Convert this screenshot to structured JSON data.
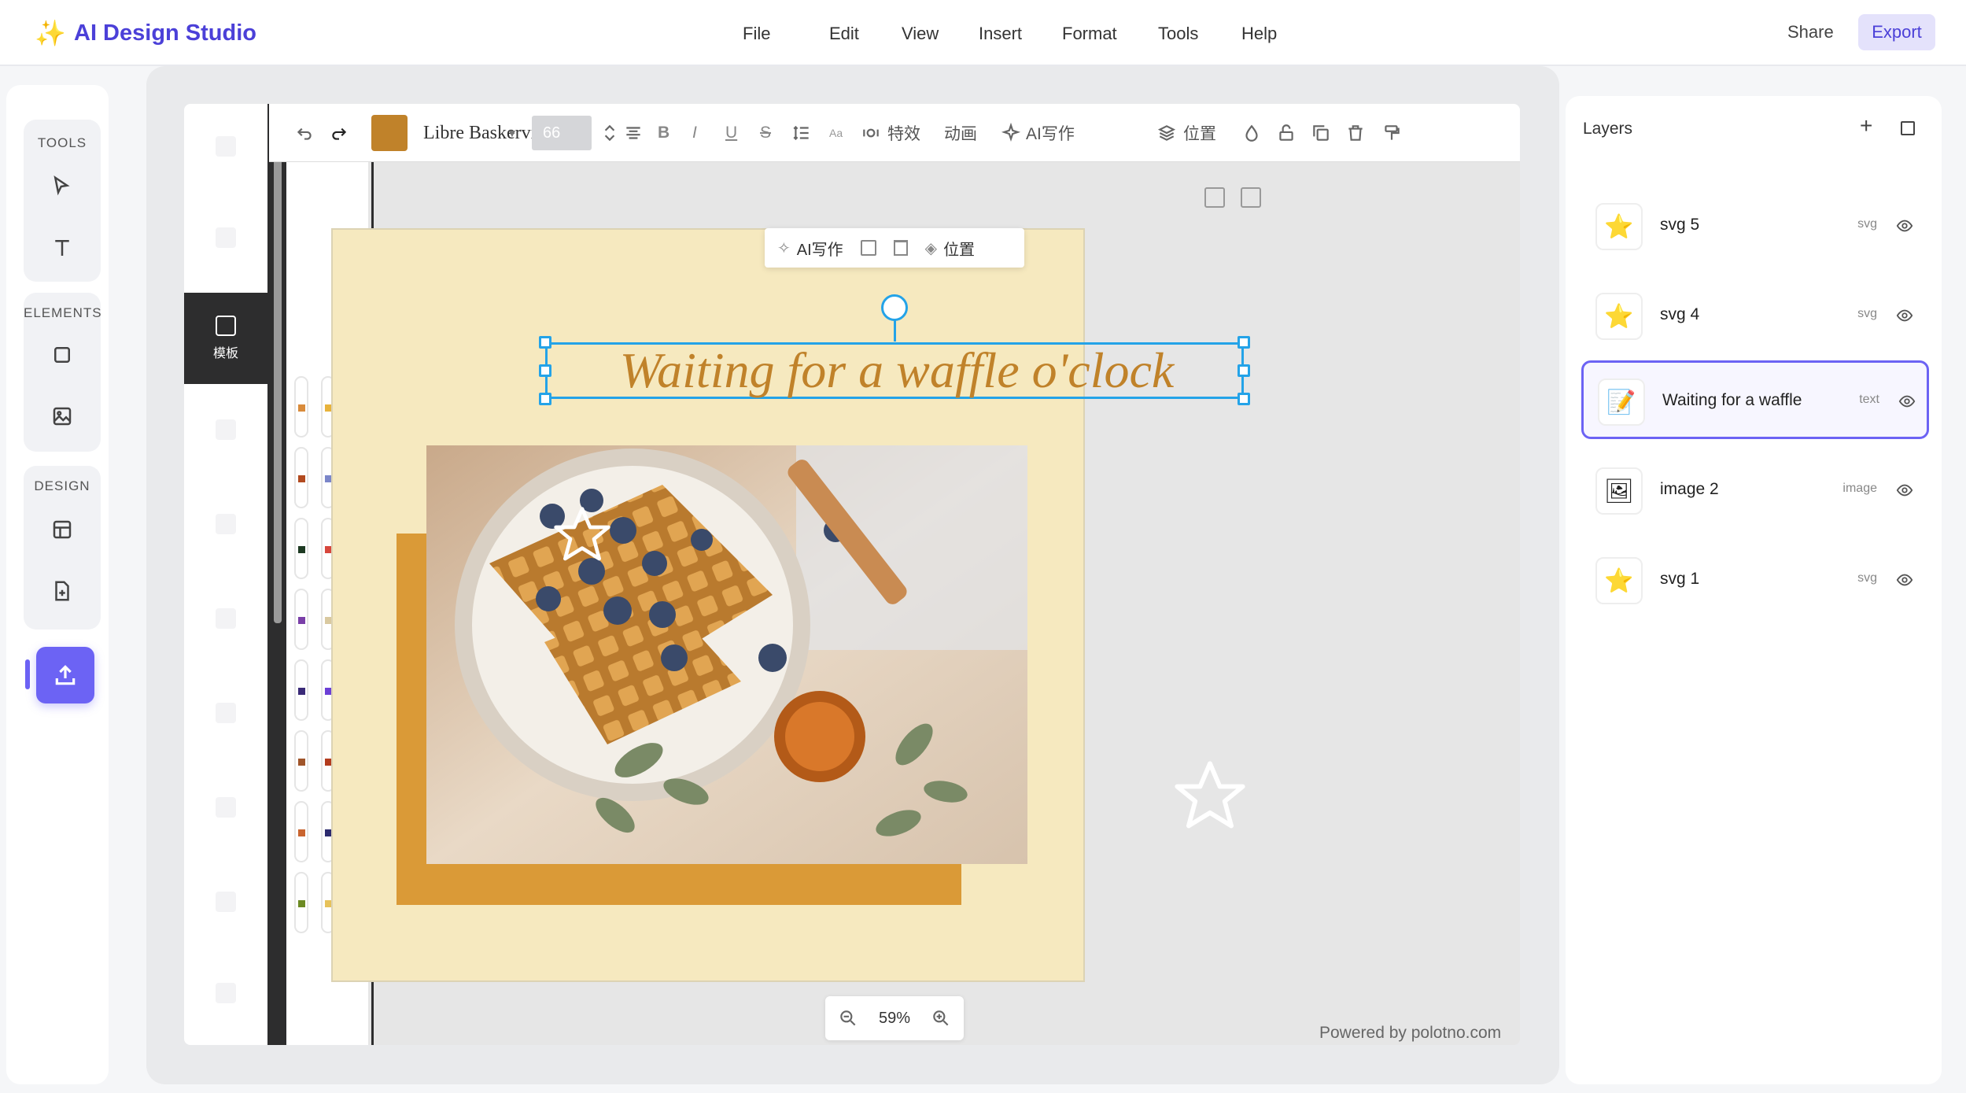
{
  "app": {
    "title": "AI Design Studio",
    "brand_icon": "sparkle-icon",
    "accent_color": "#4b40d8"
  },
  "menu": [
    "File",
    "Edit",
    "View",
    "Insert",
    "Format",
    "Tools",
    "Help"
  ],
  "header_actions": {
    "share": "Share",
    "export": "Export"
  },
  "rail": {
    "tools_label": "TOOLS",
    "elements_label": "ELEMENTS",
    "design_label": "DESIGN"
  },
  "toolbar": {
    "font_name": "Libre Baskervil...",
    "font_size": "66",
    "text_color": "#c0822a",
    "effects": "特效",
    "animation": "动画",
    "ai_write": "AI写作",
    "position": "位置"
  },
  "side_tabs": {
    "active": "模板"
  },
  "canvas": {
    "title_text": "Waiting for a waffle o'clock",
    "page_color": "#f6e9bf",
    "block_color": "#da9a37",
    "mini_ai_write": "AI写作",
    "mini_position": "位置",
    "zoom": "59%",
    "powered_by": "Powered by polotno.com"
  },
  "layers": {
    "title": "Layers",
    "items": [
      {
        "name": "svg 5",
        "type": "svg",
        "icon": "star-icon"
      },
      {
        "name": "svg 4",
        "type": "svg",
        "icon": "star-icon"
      },
      {
        "name": "Waiting for a waffle",
        "type": "text",
        "icon": "text-edit-icon",
        "selected": true
      },
      {
        "name": "image 2",
        "type": "image",
        "icon": "image-icon"
      },
      {
        "name": "svg 1",
        "type": "svg",
        "icon": "star-icon"
      }
    ]
  }
}
